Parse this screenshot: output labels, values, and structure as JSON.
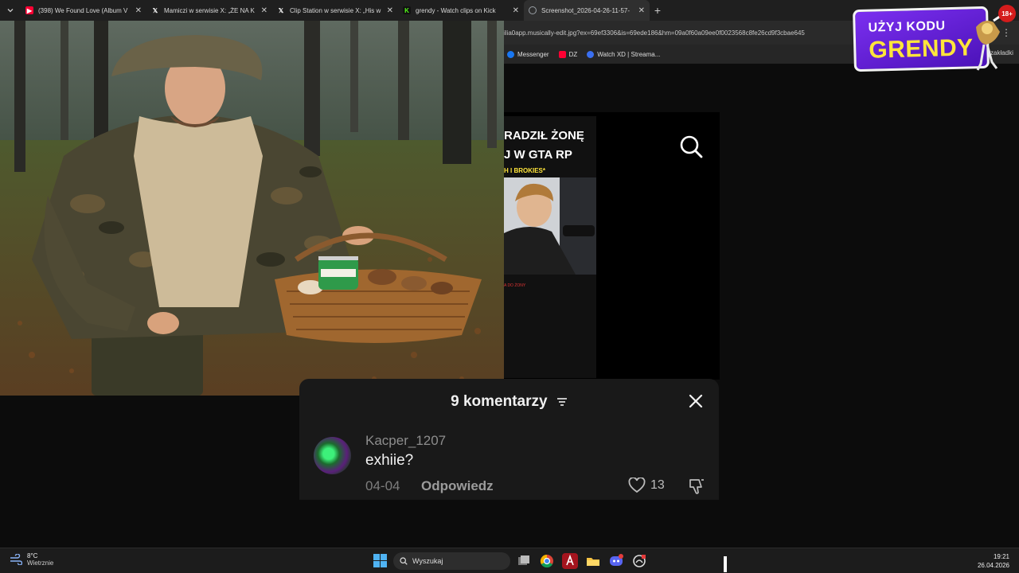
{
  "browser": {
    "tabs": [
      {
        "title": "(398) We Found Love (Album V",
        "favicon": "youtube-icon",
        "color": "#ff0033"
      },
      {
        "title": "Mamiczi w serwisie X: „ŻE NA K",
        "favicon": "x-icon",
        "color": "#ffffff"
      },
      {
        "title": "Clip Station w serwisie X: „His w",
        "favicon": "x-icon",
        "color": "#ffffff"
      },
      {
        "title": "grendy - Watch clips on Kick",
        "favicon": "kick-icon",
        "color": "#53fc18"
      },
      {
        "title": "Screenshot_2026-04-26-11-57-",
        "favicon": "globe-icon",
        "color": "#9aa0a6",
        "active": true
      }
    ],
    "address": "ilia0app.musically-edit.jpg?ex=69ef3306&is=69ede186&hm=09a0f60a09ee0f0023568c8fe26cd9f3cbae645",
    "bookmarks": [
      {
        "label": "Messenger",
        "color": "#1877f2"
      },
      {
        "label": "DZ",
        "color": "#ff0033"
      },
      {
        "label": "Watch XD | Streama...",
        "color": "#3a6ff0"
      }
    ],
    "bookmarks_right": "zakładki"
  },
  "promo": {
    "line1": "UŻYJ KODU",
    "line2": "GRENDY",
    "age": "18+"
  },
  "video": {
    "title_line1": "RADZIŁ ŻONĘ",
    "title_line2": "J W GTA RP",
    "subtitle": "H I BROKIES*",
    "small_red_text": "A DO ŻONY"
  },
  "comments": {
    "header": "9 komentarzy",
    "items": [
      {
        "user": "Kacper_1207",
        "text": "exhiie?",
        "date": "04-04",
        "reply_label": "Odpowiedz",
        "likes": "13"
      }
    ]
  },
  "taskbar": {
    "temp": "8°C",
    "condition": "Wietrznie",
    "search_placeholder": "Wyszukaj",
    "time": "19:21",
    "date": "26.04.2026"
  }
}
